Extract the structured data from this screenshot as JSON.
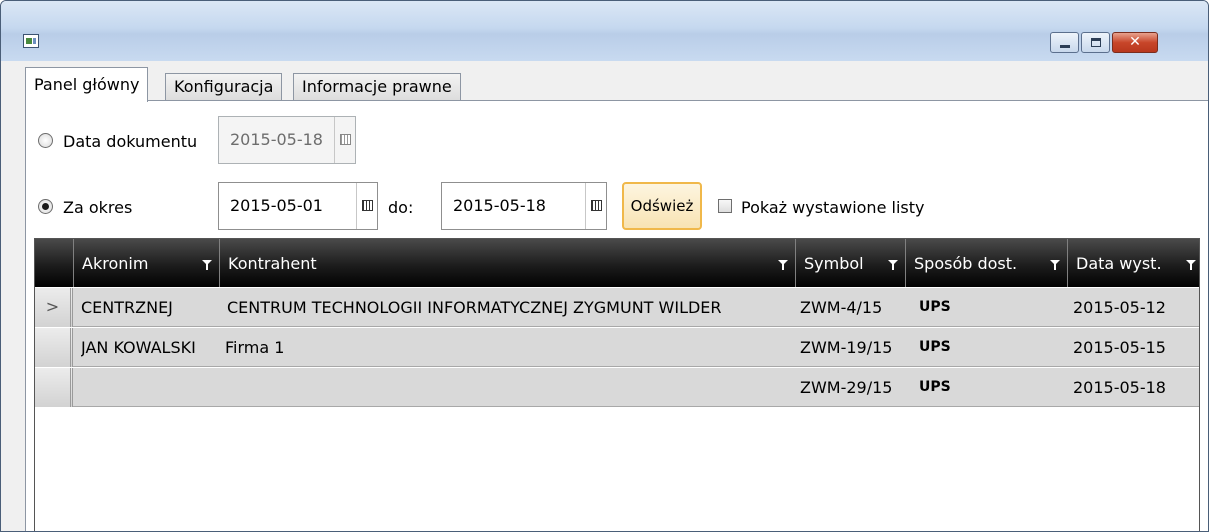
{
  "window": {
    "title": ""
  },
  "tabs": [
    {
      "label": "Panel główny",
      "active": true
    },
    {
      "label": "Konfiguracja",
      "active": false
    },
    {
      "label": "Informacje prawne",
      "active": false
    }
  ],
  "filters": {
    "doc_date": {
      "label": "Data dokumentu",
      "value": "2015-05-18",
      "checked": false,
      "enabled": false
    },
    "period": {
      "label": "Za okres",
      "checked": true,
      "from": "2015-05-01",
      "to_label": "do:",
      "to": "2015-05-18"
    },
    "refresh_label": "Odśwież",
    "show_issued": {
      "label": "Pokaż wystawione listy",
      "checked": false
    }
  },
  "grid": {
    "columns": [
      "Akronim",
      "Kontrahent",
      "Symbol",
      "Sposób dost.",
      "Data wyst."
    ],
    "rows": [
      {
        "indicator": ">",
        "akronim": "CENTRZNEJ",
        "kontrahent": "CENTRUM TECHNOLOGII INFORMATYCZNEJ ZYGMUNT WILDER",
        "symbol": "ZWM-4/15",
        "sposob": "UPS",
        "data": "2015-05-12"
      },
      {
        "indicator": "",
        "akronim": "JAN KOWALSKI",
        "kontrahent": "Firma 1",
        "symbol": "ZWM-19/15",
        "sposob": "UPS",
        "data": "2015-05-15"
      },
      {
        "indicator": "",
        "akronim": "",
        "kontrahent": "",
        "symbol": "ZWM-29/15",
        "sposob": "UPS",
        "data": "2015-05-18"
      }
    ]
  },
  "icons": {
    "app": "app-window-icon",
    "calendar": "calendar-icon",
    "filter": "filter-funnel-icon",
    "minimize": "minimize-icon",
    "maximize": "maximize-icon",
    "close": "close-icon"
  }
}
